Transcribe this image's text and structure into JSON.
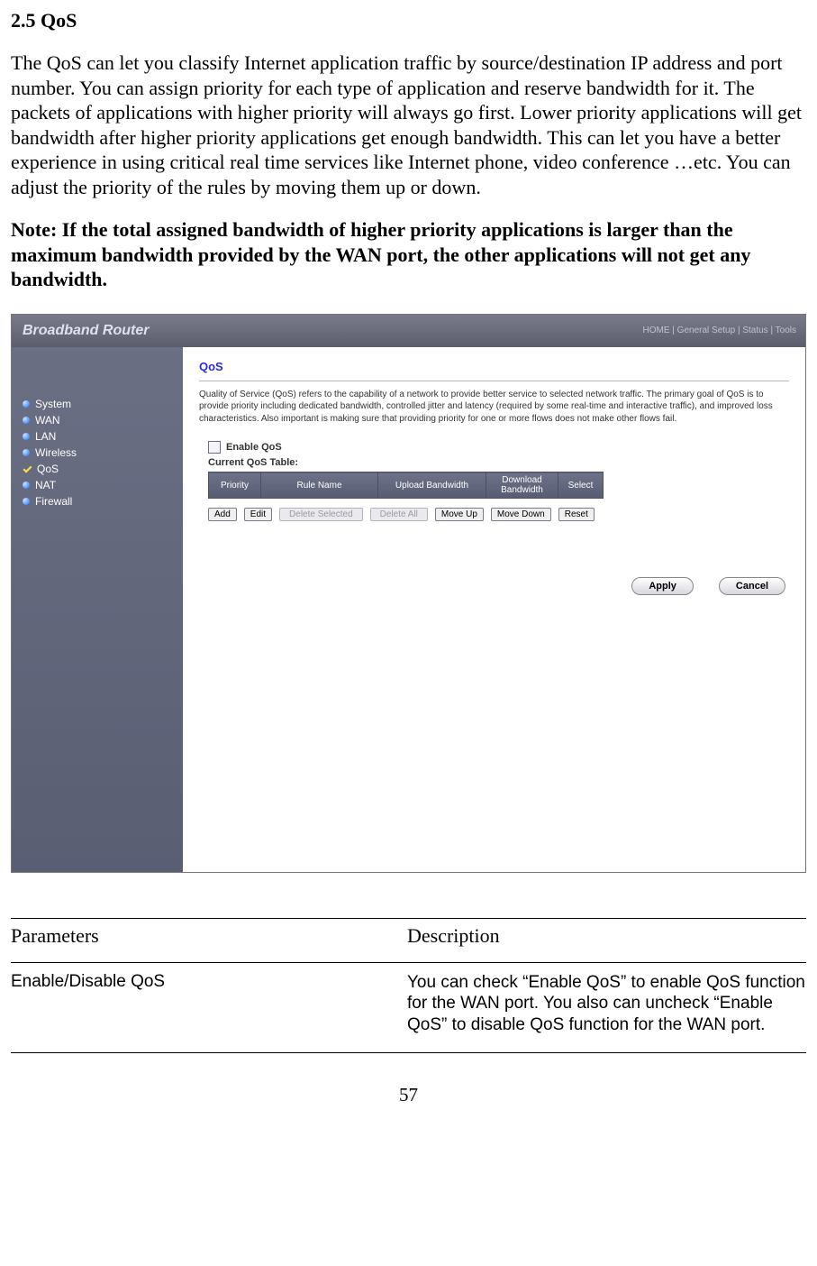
{
  "section_title": "2.5 QoS",
  "paragraph": "The QoS can let you classify Internet application traffic by source/destination IP address and port number. You can assign priority for each type of application and reserve bandwidth for it. The packets of applications with higher priority will always go first. Lower priority applications will get bandwidth after higher priority applications get enough bandwidth. This can let you have a better experience in using critical real time services like Internet phone, video conference …etc. You can adjust the priority of the rules by moving them up or down.",
  "note": "Note: If the total assigned bandwidth of higher priority applications is larger than the maximum bandwidth provided by the WAN port, the other applications will not get any bandwidth.",
  "screenshot": {
    "brand": "Broadband Router",
    "top_links": "HOME | General Setup | Status | Tools",
    "sidebar": [
      "System",
      "WAN",
      "LAN",
      "Wireless",
      "QoS",
      "NAT",
      "Firewall"
    ],
    "qos_title": "QoS",
    "qos_desc": "Quality of Service (QoS) refers to the capability of a network to provide better service to selected network traffic. The primary goal of QoS is to provide priority including dedicated bandwidth, controlled jitter and latency (required by some real-time and interactive traffic), and improved loss characteristics. Also important is making sure that providing priority for one or more flows does not make other flows fail.",
    "enable_label": "Enable QoS",
    "table_label": "Current QoS Table:",
    "columns": [
      "Priority",
      "Rule Name",
      "Upload Bandwidth",
      "Download Bandwidth",
      "Select"
    ],
    "buttons": {
      "add": "Add",
      "edit": "Edit",
      "delete_selected": "Delete Selected",
      "delete_all": "Delete All",
      "move_up": "Move Up",
      "move_down": "Move Down",
      "reset": "Reset",
      "apply": "Apply",
      "cancel": "Cancel"
    }
  },
  "params_header": {
    "col1": "Parameters",
    "col2": "Description"
  },
  "params": [
    {
      "name": "Enable/Disable QoS",
      "desc": "You can check “Enable QoS” to enable QoS function for the WAN port. You also can uncheck “Enable QoS” to disable QoS function for the WAN port."
    }
  ],
  "page_number": "57"
}
